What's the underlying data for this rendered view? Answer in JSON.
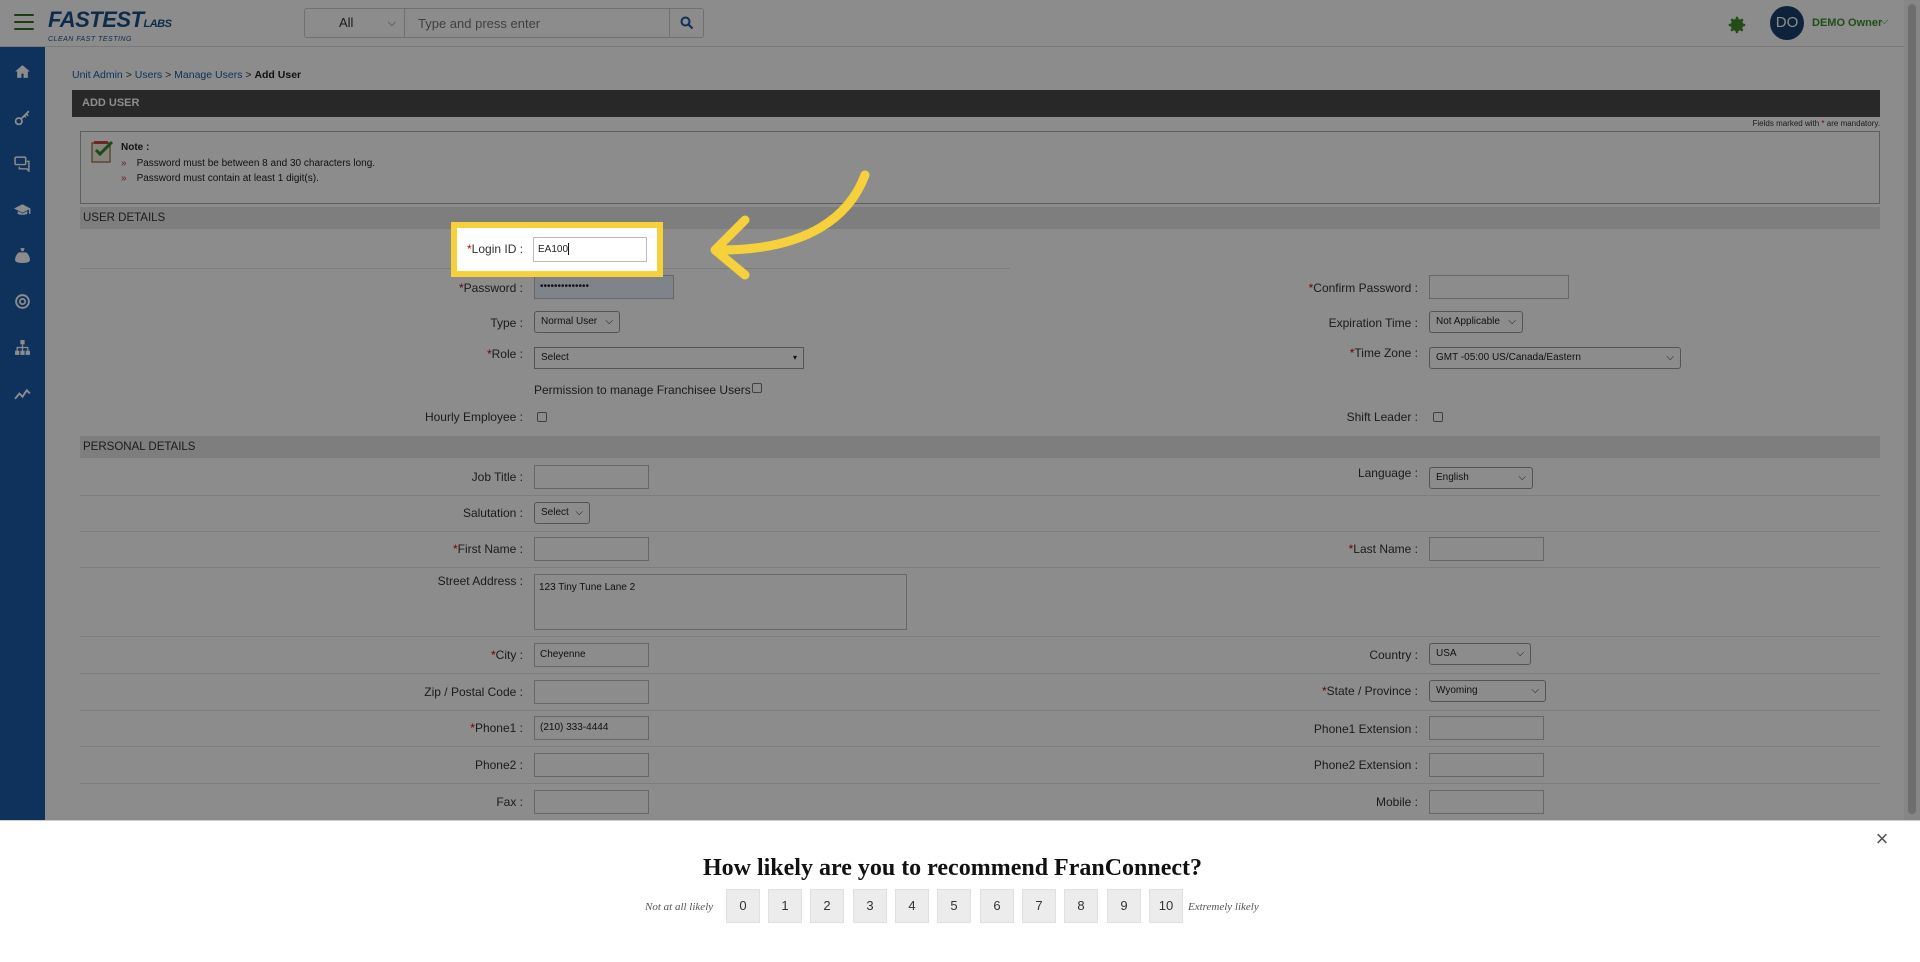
{
  "header": {
    "logo_brand": "FASTEST",
    "logo_labs": "LABS",
    "logo_tagline": "CLEAN FAST TESTING",
    "search_scope": "All",
    "search_placeholder": "Type and press enter",
    "user_initials": "DO",
    "user_name": "DEMO Owner"
  },
  "sidebar": {
    "icons": [
      "home-icon",
      "key-icon",
      "chat-icon",
      "graduation-cap-icon",
      "money-bag-icon",
      "support-icon",
      "org-chart-icon",
      "analytics-icon"
    ]
  },
  "breadcrumb": {
    "items": [
      "Unit Admin",
      "Users",
      "Manage Users"
    ],
    "separator": ">",
    "current": "Add User"
  },
  "page": {
    "title": "ADD USER",
    "mandatory_prefix": "Fields marked with",
    "mandatory_star": "*",
    "mandatory_suffix": "are mandatory."
  },
  "note": {
    "title": "Note :",
    "bullet": "»",
    "lines": [
      "Password must be between 8 and 30 characters long.",
      "Password must contain at least 1 digit(s)."
    ]
  },
  "user_details": {
    "heading": "USER DETAILS",
    "login_id_label": "Login ID :",
    "login_id_value": "EA100",
    "password_label": "Password :",
    "password_value": "••••••••••••••",
    "confirm_password_label": "Confirm Password :",
    "type_label": "Type :",
    "type_value": "Normal User",
    "expiration_label": "Expiration Time :",
    "expiration_value": "Not Applicable",
    "role_label": "Role :",
    "role_value": "Select",
    "timezone_label": "Time Zone :",
    "timezone_value": "GMT -05:00 US/Canada/Eastern",
    "permission_label": "Permission to manage Franchisee Users",
    "hourly_label": "Hourly Employee :",
    "shift_leader_label": "Shift Leader :"
  },
  "personal_details": {
    "heading": "PERSONAL DETAILS",
    "job_title_label": "Job Title :",
    "language_label": "Language :",
    "language_value": "English",
    "salutation_label": "Salutation :",
    "salutation_value": "Select",
    "first_name_label": "First Name :",
    "last_name_label": "Last Name :",
    "street_label": "Street Address :",
    "street_value": "123 Tiny Tune Lane 2",
    "city_label": "City :",
    "city_value": "Cheyenne",
    "country_label": "Country :",
    "country_value": "USA",
    "zip_label": "Zip / Postal Code :",
    "state_label": "State / Province :",
    "state_value": "Wyoming",
    "phone1_label": "Phone1 :",
    "phone1_value": "(210) 333-4444",
    "phone1_ext_label": "Phone1 Extension :",
    "phone2_label": "Phone2 :",
    "phone2_ext_label": "Phone2 Extension :",
    "fax_label": "Fax :",
    "mobile_label": "Mobile :"
  },
  "survey": {
    "question": "How likely are you to recommend FranConnect?",
    "low_label": "Not at all likely",
    "high_label": "Extremely likely",
    "scores": [
      "0",
      "1",
      "2",
      "3",
      "4",
      "5",
      "6",
      "7",
      "8",
      "9",
      "10"
    ]
  },
  "colors": {
    "sidebar": "#1a5ca8",
    "header_bar": "#4a4a4a",
    "accent_green": "#3c8d2a",
    "highlight": "#f7d13b"
  }
}
